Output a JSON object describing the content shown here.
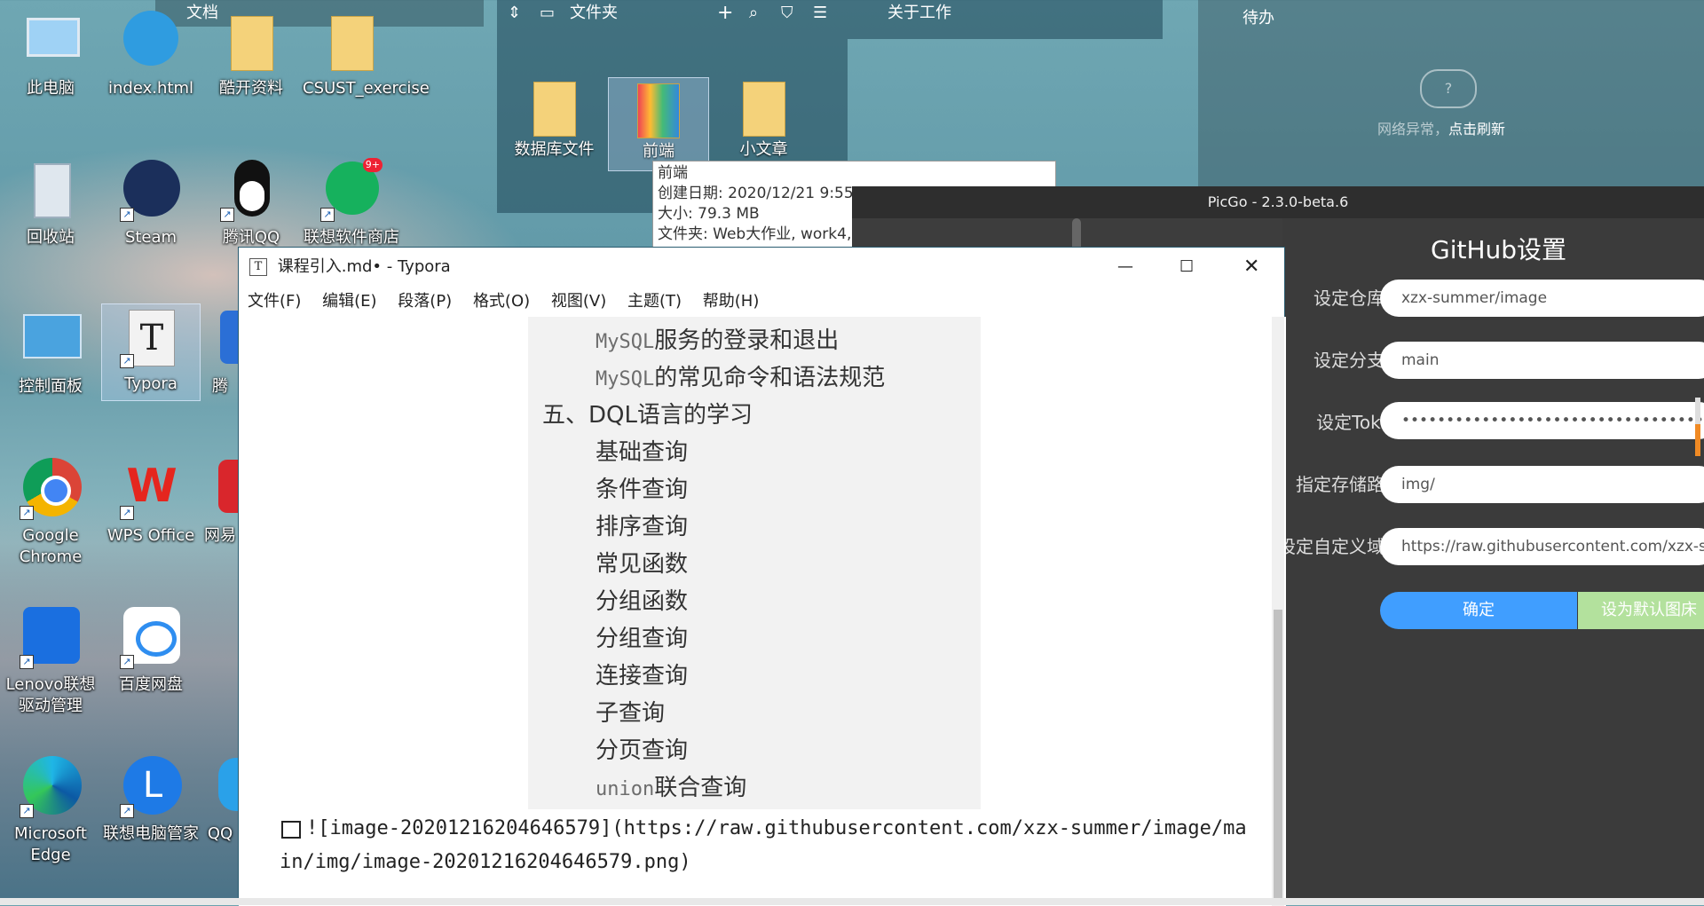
{
  "desktop": {
    "icons": [
      {
        "label": "此电脑"
      },
      {
        "label": "index.html"
      },
      {
        "label": "酷开资料"
      },
      {
        "label": "CSUST_exercise"
      },
      {
        "label": "回收站"
      },
      {
        "label": "Steam"
      },
      {
        "label": "腾讯QQ"
      },
      {
        "label": "联想软件商店",
        "badge": "9+"
      },
      {
        "label": "控制面板"
      },
      {
        "label": "Typora"
      },
      {
        "label": "腾"
      },
      {
        "label": "Google Chrome"
      },
      {
        "label": "WPS Office"
      },
      {
        "label": "网易"
      },
      {
        "label": "Lenovo联想驱动管理"
      },
      {
        "label": "百度网盘"
      },
      {
        "label": "Microsoft Edge"
      },
      {
        "label": "联想电脑管家"
      },
      {
        "label": "QQ"
      }
    ]
  },
  "fences": {
    "docs_title": "文档",
    "folder_title": "文件夹",
    "work_title": "关于工作",
    "todo_title": "待办",
    "folders": [
      {
        "label": "数据库文件"
      },
      {
        "label": "前端"
      },
      {
        "label": "小文章"
      }
    ],
    "network": {
      "text": "网络异常，",
      "link": "点击刷新"
    }
  },
  "tooltip": {
    "name": "前端",
    "created": "创建日期: 2020/12/21 9:55",
    "size": "大小: 79.3 MB",
    "folders": "文件夹: Web大作业, work4,"
  },
  "picgo": {
    "window_title": "PicGo - 2.3.0-beta.6",
    "heading": "GitHub设置",
    "fields": [
      {
        "label": "设定仓库名",
        "value": "xzx-summer/image"
      },
      {
        "label": "设定分支名",
        "value": "main"
      },
      {
        "label": "设定Token",
        "value": "••••••••••••••••••••••••••••••••••••••••"
      },
      {
        "label": "指定存储路径",
        "value": "img/"
      },
      {
        "label": "设定自定义域名",
        "value": "https://raw.githubusercontent.com/xzx-summer"
      }
    ],
    "ok_button": "确定",
    "default_button": "设为默认图床"
  },
  "typora": {
    "window_title": "课程引入.md• - Typora",
    "menu": [
      "文件(F)",
      "编辑(E)",
      "段落(P)",
      "格式(O)",
      "视图(V)",
      "主题(T)",
      "帮助(H)"
    ],
    "toc": [
      {
        "prefix": "MySQL",
        "text": "服务的登录和退出",
        "level": 2
      },
      {
        "prefix": "MySQL",
        "text": "的常见命令和语法规范",
        "level": 2
      },
      {
        "prefix": "五、DQL",
        "text": "语言的学习",
        "level": 1
      },
      {
        "prefix": "",
        "text": "基础查询",
        "level": 2
      },
      {
        "prefix": "",
        "text": "条件查询",
        "level": 2
      },
      {
        "prefix": "",
        "text": "排序查询",
        "level": 2
      },
      {
        "prefix": "",
        "text": "常见函数",
        "level": 2
      },
      {
        "prefix": "",
        "text": "分组函数",
        "level": 2
      },
      {
        "prefix": "",
        "text": "分组查询",
        "level": 2
      },
      {
        "prefix": "",
        "text": "连接查询",
        "level": 2
      },
      {
        "prefix": "",
        "text": "子查询",
        "level": 2
      },
      {
        "prefix": "",
        "text": "分页查询",
        "level": 2
      },
      {
        "prefix": "union",
        "text": "联合查询",
        "level": 2
      }
    ],
    "md_line1": "![image-20201216204646579](https://raw.githubusercontent.com/xzx-summer/image/ma",
    "md_line2": "in/img/image-20201216204646579.png)"
  }
}
